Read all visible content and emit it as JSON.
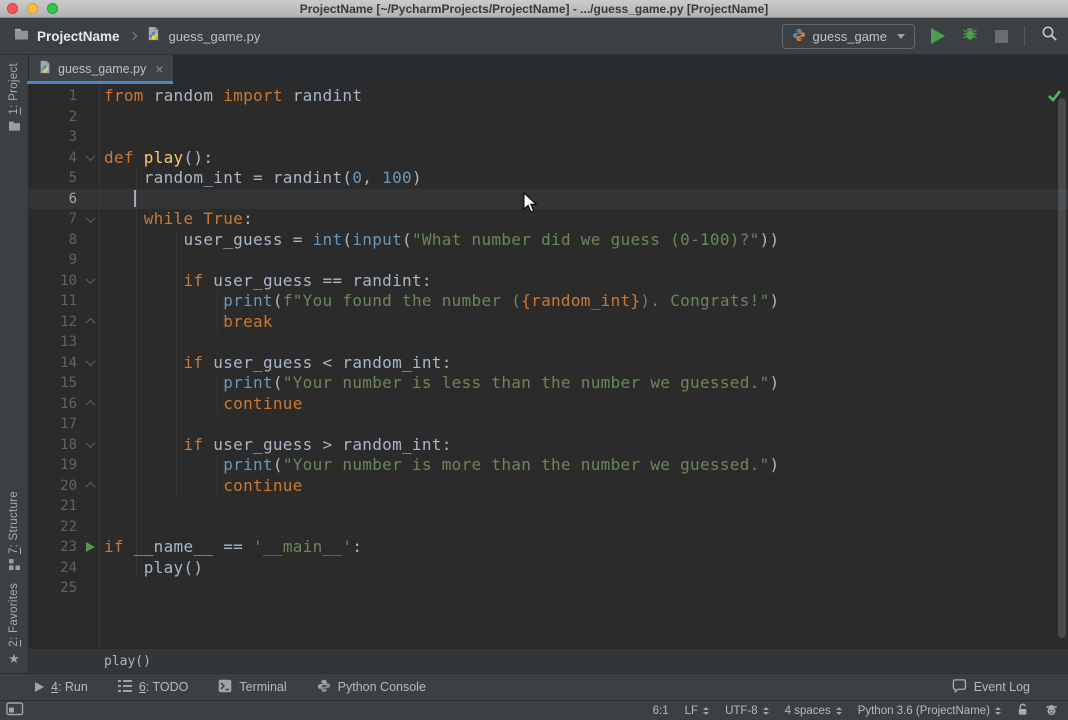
{
  "window": {
    "title": "ProjectName [~/PycharmProjects/ProjectName] - .../guess_game.py [ProjectName]"
  },
  "toolbar": {
    "breadcrumb": {
      "project": "ProjectName",
      "file": "guess_game.py"
    },
    "run_config": "guess_game"
  },
  "tab": {
    "label": "guess_game.py",
    "close": "×"
  },
  "left_stripe": [
    {
      "mnemonic": "1",
      "rest": ": Project"
    },
    {
      "mnemonic": "7",
      "rest": ": Structure"
    },
    {
      "mnemonic": "2",
      "rest": ": Favorites"
    }
  ],
  "editor": {
    "breadcrumb": "play()",
    "lines": [
      {
        "n": 1,
        "icon": null,
        "cur": false,
        "seg": [
          [
            "kw",
            "from"
          ],
          [
            "pl",
            " random "
          ],
          [
            "kw",
            "import"
          ],
          [
            "pl",
            " randint"
          ]
        ]
      },
      {
        "n": 2,
        "icon": null,
        "cur": false,
        "seg": []
      },
      {
        "n": 3,
        "icon": null,
        "cur": false,
        "seg": []
      },
      {
        "n": 4,
        "icon": "fold-down",
        "cur": false,
        "seg": [
          [
            "kw",
            "def"
          ],
          [
            "pl",
            " "
          ],
          [
            "fn",
            "play"
          ],
          [
            "pl",
            "():"
          ]
        ]
      },
      {
        "n": 5,
        "icon": null,
        "cur": false,
        "seg": [
          [
            "pl",
            "    random_int = randint("
          ],
          [
            "num",
            "0"
          ],
          [
            "pl",
            ", "
          ],
          [
            "num",
            "100"
          ],
          [
            "pl",
            ")"
          ]
        ]
      },
      {
        "n": 6,
        "icon": null,
        "cur": true,
        "seg": []
      },
      {
        "n": 7,
        "icon": "fold-down",
        "cur": false,
        "seg": [
          [
            "pl",
            "    "
          ],
          [
            "kw",
            "while"
          ],
          [
            "pl",
            " "
          ],
          [
            "kw",
            "True"
          ],
          [
            "pl",
            ":"
          ]
        ]
      },
      {
        "n": 8,
        "icon": null,
        "cur": false,
        "seg": [
          [
            "pl",
            "        user_guess = "
          ],
          [
            "bi",
            "int"
          ],
          [
            "pl",
            "("
          ],
          [
            "bi",
            "input"
          ],
          [
            "pl",
            "("
          ],
          [
            "str",
            "\"What number did we guess (0-100)?\""
          ],
          [
            "pl",
            "))"
          ]
        ]
      },
      {
        "n": 9,
        "icon": null,
        "cur": false,
        "seg": []
      },
      {
        "n": 10,
        "icon": "fold-down",
        "cur": false,
        "seg": [
          [
            "pl",
            "        "
          ],
          [
            "kw",
            "if"
          ],
          [
            "pl",
            " user_guess == randint:"
          ]
        ]
      },
      {
        "n": 11,
        "icon": null,
        "cur": false,
        "seg": [
          [
            "pl",
            "            "
          ],
          [
            "bi",
            "print"
          ],
          [
            "pl",
            "("
          ],
          [
            "str",
            "f\"You found the number ("
          ],
          [
            "fx",
            "{random_int}"
          ],
          [
            "str",
            "). Congrats!\""
          ],
          [
            "pl",
            ")"
          ]
        ]
      },
      {
        "n": 12,
        "icon": "fold-up",
        "cur": false,
        "seg": [
          [
            "pl",
            "            "
          ],
          [
            "kw",
            "break"
          ]
        ]
      },
      {
        "n": 13,
        "icon": null,
        "cur": false,
        "seg": []
      },
      {
        "n": 14,
        "icon": "fold-down",
        "cur": false,
        "seg": [
          [
            "pl",
            "        "
          ],
          [
            "kw",
            "if"
          ],
          [
            "pl",
            " user_guess < random_int:"
          ]
        ]
      },
      {
        "n": 15,
        "icon": null,
        "cur": false,
        "seg": [
          [
            "pl",
            "            "
          ],
          [
            "bi",
            "print"
          ],
          [
            "pl",
            "("
          ],
          [
            "str",
            "\"Your number is less than the number we guessed.\""
          ],
          [
            "pl",
            ")"
          ]
        ]
      },
      {
        "n": 16,
        "icon": "fold-up",
        "cur": false,
        "seg": [
          [
            "pl",
            "            "
          ],
          [
            "kw",
            "continue"
          ]
        ]
      },
      {
        "n": 17,
        "icon": null,
        "cur": false,
        "seg": []
      },
      {
        "n": 18,
        "icon": "fold-down",
        "cur": false,
        "seg": [
          [
            "pl",
            "        "
          ],
          [
            "kw",
            "if"
          ],
          [
            "pl",
            " user_guess > random_int:"
          ]
        ]
      },
      {
        "n": 19,
        "icon": null,
        "cur": false,
        "seg": [
          [
            "pl",
            "            "
          ],
          [
            "bi",
            "print"
          ],
          [
            "pl",
            "("
          ],
          [
            "str",
            "\"Your number is more than the number we guessed.\""
          ],
          [
            "pl",
            ")"
          ]
        ]
      },
      {
        "n": 20,
        "icon": "fold-up",
        "cur": false,
        "seg": [
          [
            "pl",
            "            "
          ],
          [
            "kw",
            "continue"
          ]
        ]
      },
      {
        "n": 21,
        "icon": null,
        "cur": false,
        "seg": []
      },
      {
        "n": 22,
        "icon": null,
        "cur": false,
        "seg": []
      },
      {
        "n": 23,
        "icon": "run",
        "cur": false,
        "seg": [
          [
            "kw",
            "if"
          ],
          [
            "pl",
            " __name__ == "
          ],
          [
            "str",
            "'__main__'"
          ],
          [
            "pl",
            ":"
          ]
        ]
      },
      {
        "n": 24,
        "icon": null,
        "cur": false,
        "seg": [
          [
            "pl",
            "    play()"
          ]
        ]
      },
      {
        "n": 25,
        "icon": null,
        "cur": false,
        "seg": []
      }
    ]
  },
  "toolwindow_bar": {
    "items": [
      {
        "mnemonic": "4",
        "rest": ": Run"
      },
      {
        "mnemonic": "6",
        "rest": ": TODO"
      },
      {
        "mnemonic": "",
        "rest": "Terminal"
      },
      {
        "mnemonic": "",
        "rest": "Python Console"
      }
    ],
    "event_log": "Event Log"
  },
  "status_bar": {
    "caret": "6:1",
    "line_ending": "LF",
    "encoding": "UTF-8",
    "indent": "4 spaces",
    "interpreter": "Python 3.6 (ProjectName)"
  },
  "colors": {
    "editor_bg": "#2B2B2B",
    "current_line": "#323436",
    "keyword": "#CC7832",
    "string": "#6A8759",
    "number_builtin": "#6897BB",
    "function_def": "#FFC66D",
    "default_text": "#A9B7C6",
    "line_number": "#606366",
    "tab_underline": "#4A86C8",
    "run_green": "#4C9E4F",
    "ui_bg": "#3D4042"
  }
}
